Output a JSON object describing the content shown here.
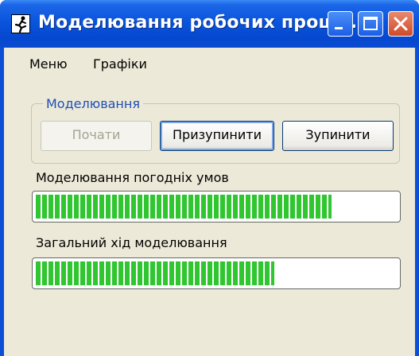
{
  "window": {
    "title": "Моделювання робочих проце..."
  },
  "menu": {
    "items": [
      "Меню",
      "Графіки"
    ]
  },
  "group": {
    "label": "Моделювання"
  },
  "buttons": {
    "start": "Почати",
    "pause": "Призупинити",
    "stop": "Зупинити"
  },
  "progress": [
    {
      "label": "Моделювання погодніх умов",
      "value": 0.82
    },
    {
      "label": "Загальний хід моделювання",
      "value": 0.66
    }
  ],
  "colors": {
    "title_bar": "#0a55dc",
    "progress_fill": "#2fc62f",
    "group_label": "#1d4fb5",
    "client_bg": "#ece9d8"
  }
}
